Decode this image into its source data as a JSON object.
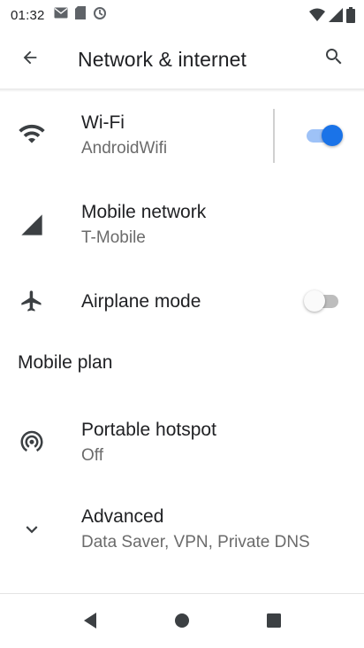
{
  "status_bar": {
    "time": "01:32",
    "left_icons": [
      "email-icon",
      "sd-card-icon",
      "sync-icon"
    ],
    "right_icons": [
      "wifi-signal-icon",
      "cellular-signal-icon",
      "battery-icon"
    ]
  },
  "toolbar": {
    "title": "Network & internet",
    "back_icon": "arrow-back-icon",
    "search_icon": "search-icon"
  },
  "settings": {
    "wifi": {
      "title": "Wi-Fi",
      "subtitle": "AndroidWifi",
      "enabled": true,
      "icon": "wifi-icon"
    },
    "mobile_network": {
      "title": "Mobile network",
      "subtitle": "T-Mobile",
      "icon": "cellular-icon"
    },
    "airplane_mode": {
      "title": "Airplane mode",
      "enabled": false,
      "icon": "airplane-icon"
    },
    "mobile_plan": {
      "title": "Mobile plan"
    },
    "hotspot": {
      "title": "Portable hotspot",
      "subtitle": "Off",
      "icon": "hotspot-icon"
    },
    "advanced": {
      "title": "Advanced",
      "subtitle": "Data Saver, VPN, Private DNS",
      "icon": "chevron-down-icon"
    }
  },
  "nav_bar": {
    "buttons": [
      "back-triangle-icon",
      "home-circle-icon",
      "recents-square-icon"
    ]
  },
  "colors": {
    "accent": "#1a73e8",
    "icon": "#3c4043",
    "secondary_text": "#6b6b6b"
  }
}
